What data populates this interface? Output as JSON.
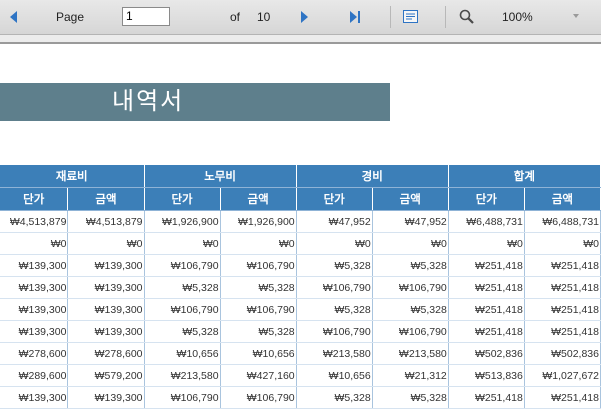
{
  "toolbar": {
    "page_label": "Page",
    "page_value": "1",
    "of_label": "of",
    "total_pages": "10",
    "zoom_value": "100%",
    "accent_color": "#2e74c4"
  },
  "document": {
    "title": "내역서"
  },
  "table": {
    "groups": [
      "재료비",
      "노무비",
      "경비",
      "합계"
    ],
    "subheaders": [
      "단가",
      "금액",
      "단가",
      "금액",
      "단가",
      "금액",
      "단가",
      "금액"
    ],
    "rows": [
      [
        "₩4,513,879",
        "₩4,513,879",
        "₩1,926,900",
        "₩1,926,900",
        "₩47,952",
        "₩47,952",
        "₩6,488,731",
        "₩6,488,731"
      ],
      [
        "₩0",
        "₩0",
        "₩0",
        "₩0",
        "₩0",
        "₩0",
        "₩0",
        "₩0"
      ],
      [
        "₩139,300",
        "₩139,300",
        "₩106,790",
        "₩106,790",
        "₩5,328",
        "₩5,328",
        "₩251,418",
        "₩251,418"
      ],
      [
        "₩139,300",
        "₩139,300",
        "₩5,328",
        "₩5,328",
        "₩106,790",
        "₩106,790",
        "₩251,418",
        "₩251,418"
      ],
      [
        "₩139,300",
        "₩139,300",
        "₩106,790",
        "₩106,790",
        "₩5,328",
        "₩5,328",
        "₩251,418",
        "₩251,418"
      ],
      [
        "₩139,300",
        "₩139,300",
        "₩5,328",
        "₩5,328",
        "₩106,790",
        "₩106,790",
        "₩251,418",
        "₩251,418"
      ],
      [
        "₩278,600",
        "₩278,600",
        "₩10,656",
        "₩10,656",
        "₩213,580",
        "₩213,580",
        "₩502,836",
        "₩502,836"
      ],
      [
        "₩289,600",
        "₩579,200",
        "₩213,580",
        "₩427,160",
        "₩10,656",
        "₩21,312",
        "₩513,836",
        "₩1,027,672"
      ],
      [
        "₩139,300",
        "₩139,300",
        "₩106,790",
        "₩106,790",
        "₩5,328",
        "₩5,328",
        "₩251,418",
        "₩251,418"
      ]
    ]
  }
}
